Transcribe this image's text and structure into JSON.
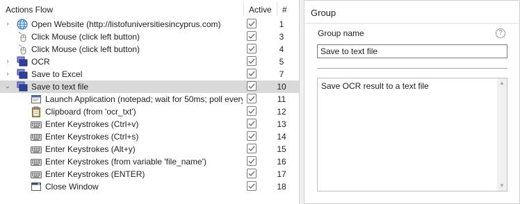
{
  "actions_panel": {
    "columns": {
      "name": "Actions Flow",
      "active": "Active",
      "number": "#"
    },
    "rows": [
      {
        "arrow": "›",
        "icon": "globe-icon",
        "label": "Open Website (http://listofuniversitiesincyprus.com)",
        "active": true,
        "number": "1",
        "level": 0
      },
      {
        "arrow": "",
        "icon": "mouse-icon",
        "label": "Click Mouse (click left button)",
        "active": true,
        "number": "3",
        "level": 0
      },
      {
        "arrow": "",
        "icon": "mouse-icon",
        "label": "Click Mouse (click left button)",
        "active": true,
        "number": "4",
        "level": 0
      },
      {
        "arrow": "›",
        "icon": "group-icon",
        "label": "OCR",
        "active": true,
        "number": "5",
        "level": 0
      },
      {
        "arrow": "›",
        "icon": "group-icon",
        "label": "Save to Excel",
        "active": true,
        "number": "7",
        "level": 0
      },
      {
        "arrow": "⌄",
        "icon": "group-icon",
        "label": "Save to text file",
        "active": true,
        "number": "10",
        "level": 0,
        "selected": true
      },
      {
        "arrow": "",
        "icon": "application-icon",
        "label": "Launch Application (notepad; wait for 50ms; poll every",
        "active": true,
        "number": "11",
        "level": 1
      },
      {
        "arrow": "",
        "icon": "clipboard-icon",
        "label": "Clipboard (from 'ocr_txt')",
        "active": true,
        "number": "12",
        "level": 1
      },
      {
        "arrow": "",
        "icon": "keyboard-icon",
        "label": "Enter Keystrokes (Ctrl+v)",
        "active": true,
        "number": "13",
        "level": 1
      },
      {
        "arrow": "",
        "icon": "keyboard-icon",
        "label": "Enter Keystrokes (Ctrl+s)",
        "active": true,
        "number": "14",
        "level": 1
      },
      {
        "arrow": "",
        "icon": "keyboard-icon",
        "label": "Enter Keystrokes (Alt+y)",
        "active": true,
        "number": "15",
        "level": 1
      },
      {
        "arrow": "",
        "icon": "keyboard-icon",
        "label": "Enter Keystrokes (from variable 'file_name')",
        "active": true,
        "number": "16",
        "level": 1
      },
      {
        "arrow": "",
        "icon": "keyboard-icon",
        "label": "Enter Keystrokes (ENTER)",
        "active": true,
        "number": "17",
        "level": 1
      },
      {
        "arrow": "",
        "icon": "close-window-icon",
        "label": "Close Window",
        "active": true,
        "number": "18",
        "level": 1
      }
    ]
  },
  "properties_panel": {
    "title": "Group",
    "name_label": "Group name",
    "help_icon": "help-icon",
    "help_glyph": "?",
    "name_value": "Save to text file",
    "notes_value": "Save OCR result to a text file",
    "scroll_up_glyph": "▲",
    "scroll_down_glyph": "▼"
  },
  "colors": {
    "selected_row": "#d9d9d9",
    "group_icon": "#2f3f9e",
    "globe_icon": "#3a78c8"
  }
}
